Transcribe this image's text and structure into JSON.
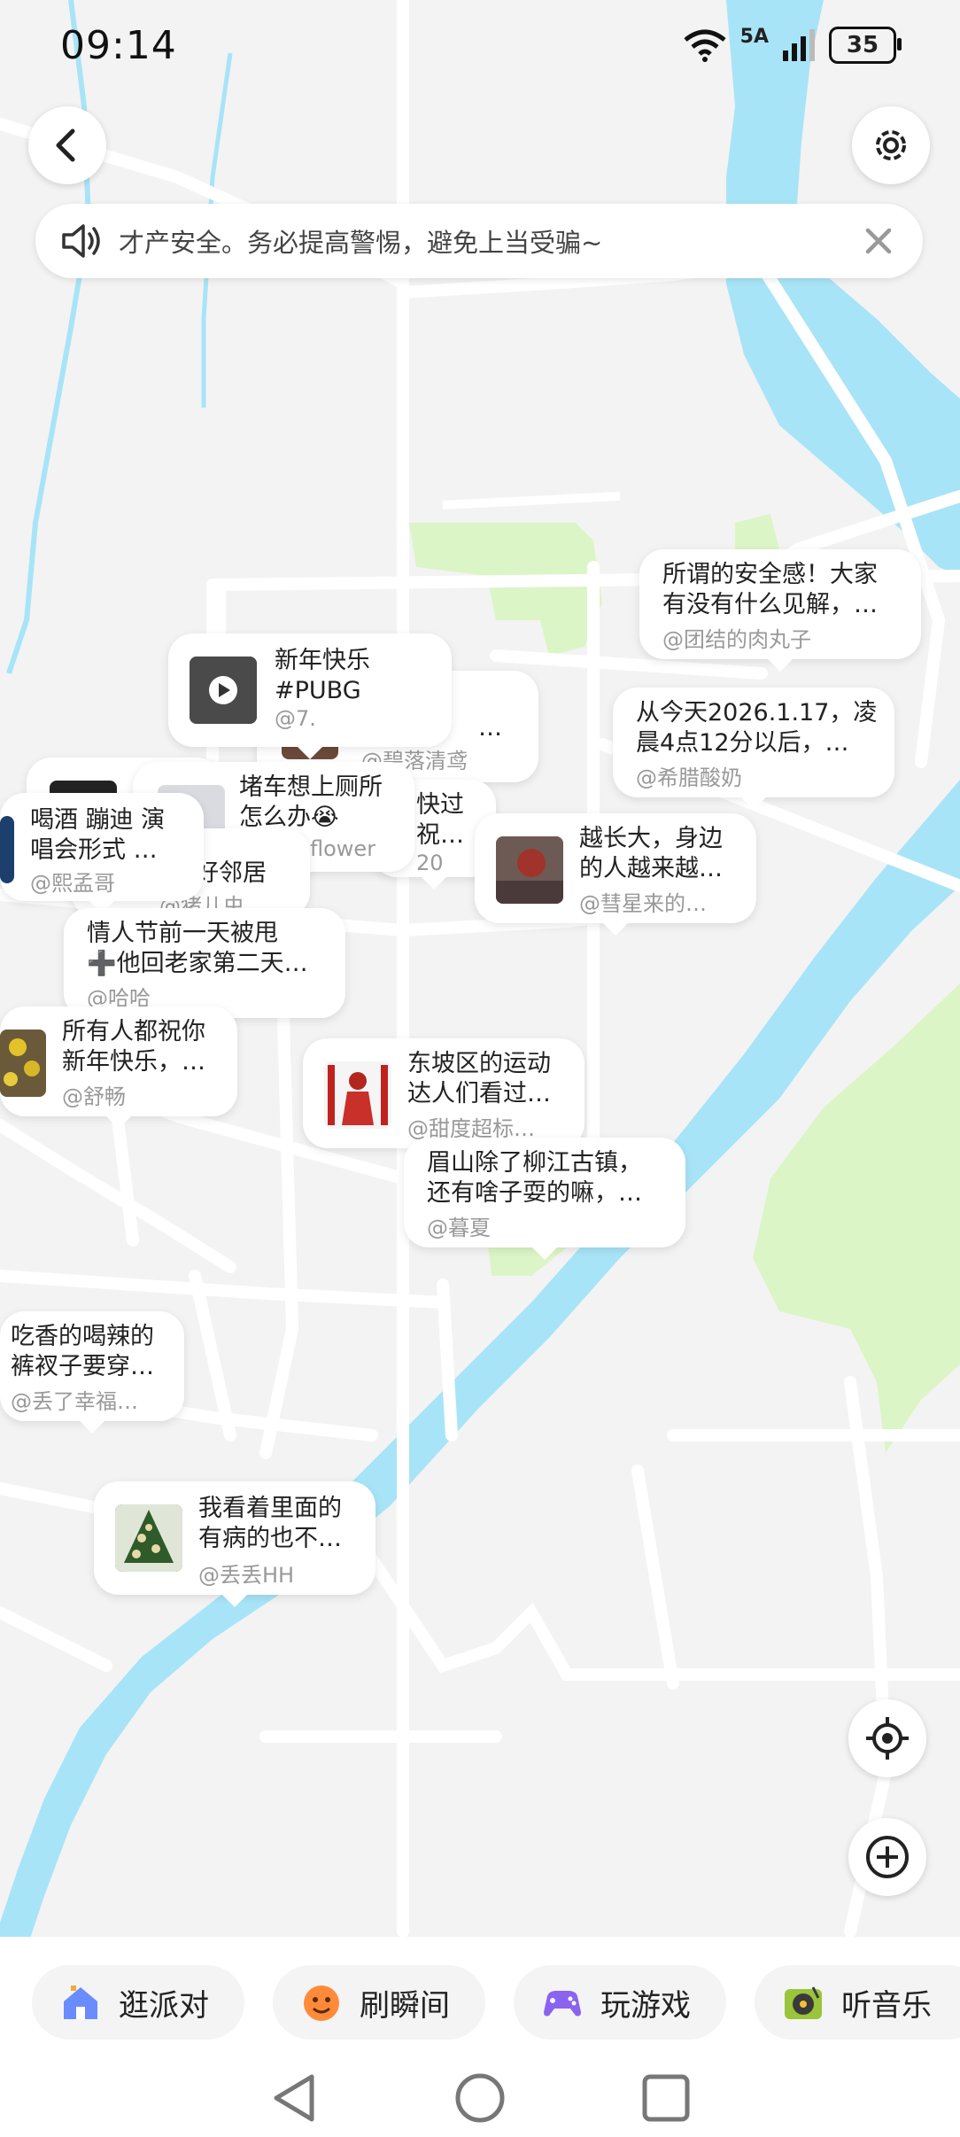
{
  "status_bar": {
    "time": "09:14",
    "network": "5A",
    "battery": "35"
  },
  "notice": {
    "text": "才产安全。务必提高警惕，避免上当受骗~"
  },
  "bubbles": [
    {
      "title1": "所谓的安全感！大家",
      "title2": "有没有什么见解，…",
      "user": "@团结的肉丸子"
    },
    {
      "title1": "新年快乐",
      "title2": "#PUBG",
      "user": "@7."
    },
    {
      "title1": "",
      "title2": "…",
      "user": "@碧落清鸢"
    },
    {
      "title1": "从今天2026.1.17，凌",
      "title2": "晨4点12分以后，…",
      "user": "@希腊酸奶"
    },
    {
      "title1": "堵车想上厕所",
      "title2": "怎么办😭",
      "user": "flower"
    },
    {
      "title1": "快过",
      "title2": "祝…",
      "user": "20"
    },
    {
      "title1": "喝酒 蹦迪 演",
      "title2": "唱会形式 …",
      "user": "@熙孟哥"
    },
    {
      "title1": "好邻居",
      "title2": "",
      "user": "@猪儿虫"
    },
    {
      "title1": "越长大，身边",
      "title2": "的人越来越…",
      "user": "@彗星来的…"
    },
    {
      "title1": "情人节前一天被甩",
      "title2": "➕他回老家第二天…",
      "user": "@哈哈"
    },
    {
      "title1": "所有人都祝你",
      "title2": "新年快乐，…",
      "user": "@舒畅"
    },
    {
      "title1": "东坡区的运动",
      "title2": "达人们看过…",
      "user": "@甜度超标…"
    },
    {
      "title1": "眉山除了柳江古镇，",
      "title2": "还有啥子耍的嘛，…",
      "user": "@暮夏"
    },
    {
      "title1": "吃香的喝辣的",
      "title2": "裤衩子要穿…",
      "user": "@丢了幸福…"
    },
    {
      "title1": "我看着里面的",
      "title2": "有病的也不…",
      "user": "@丢丢HH"
    }
  ],
  "tabs": [
    {
      "label": "逛派对",
      "icon": "house-icon",
      "color": "#6a8cff"
    },
    {
      "label": "刷瞬间",
      "icon": "face-icon",
      "color": "#ff8a3a"
    },
    {
      "label": "玩游戏",
      "icon": "gamepad-icon",
      "color": "#8a63f0"
    },
    {
      "label": "听音乐",
      "icon": "record-icon",
      "color": "#9ac43a"
    }
  ],
  "colors": {
    "river": "#a8e4f7",
    "park": "#dcf5c6",
    "road": "#ffffff",
    "background": "#f3f3f3"
  }
}
